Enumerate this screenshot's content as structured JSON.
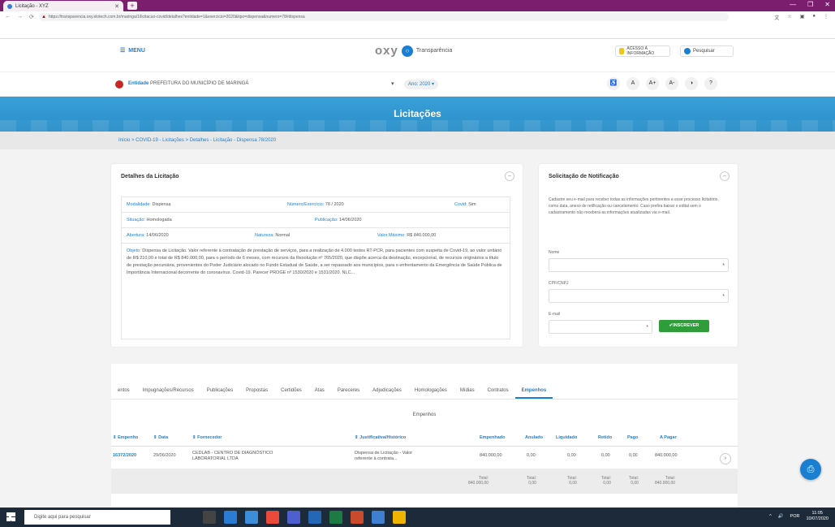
{
  "browser": {
    "tab_title": "Licitação - XYZ",
    "url": "https://transparencia.oxy.elotech.com.br/maringa/1/licitacao-covid/detalhes?entidade=1&exercicio=2020&tipo=dispensa&numero=78#dispensa",
    "new_tab": "+",
    "win_minimize": "—",
    "win_maximize": "❐",
    "win_close": "✕",
    "back": "←",
    "forward": "→",
    "reload": "⟳",
    "lock": "▲"
  },
  "header": {
    "menu_label": "MENU",
    "logo_word": "oxy",
    "logo_mark": "○",
    "logo_text": "Transparência",
    "acesso_label": "ACESSO À INFORMAÇÃO",
    "pesquisar_label": "Pesquisar"
  },
  "entity": {
    "label": "Entidade",
    "value": "PREFEITURA DO MUNICÍPIO DE MARINGÁ",
    "caret": "▾",
    "ano": "Ano: 2020 ▾",
    "tools": [
      "♿",
      "A",
      "A+",
      "A-",
      "◑",
      "?"
    ]
  },
  "banner": {
    "title": "Licitações"
  },
  "breadcrumb": "Início  >  COVID-19 - Licitações  >  Detalhes - Licitação - Dispensa 78/2020",
  "details": {
    "title": "Detalhes da Licitação",
    "toggle": "−",
    "modalidade_label": "Modalidade:",
    "modalidade": "Dispensa",
    "numero_label": "Número/Exercício:",
    "numero": "78 / 2020",
    "covid_label": "Covid:",
    "covid": "Sim",
    "situacao_label": "Situação:",
    "situacao": "Homologada",
    "publicacao_label": "Publicação:",
    "publicacao": "14/06/2020",
    "abertura_label": "Abertura:",
    "abertura": "14/06/2020",
    "natureza_label": "Natureza:",
    "natureza": "Normal",
    "valor_label": "Valor Máximo:",
    "valor": "R$ 840.000,00",
    "objeto_label": "Objeto:",
    "objeto": "Dispensa de Licitação. Valor referente à contratação de prestação de serviços, para a realização de 4.000 testes RT-PCR, para pacientes com suspeita de Covid-19, ao valor unitário de R$ 210,00 e total de R$ 840.000,00, para o período de 6 meses, com recursos da Resolução nº 765/2020, que dispõe acerca da destinação, excepcional, de recursos originários a título de prestação pecuniária, provenientes do Poder Judiciário alocado no Fundo Estadual de Saúde, a ser repassado aos municípios, para o enfrentamento da Emergência de Saúde Pública de Importância Internacional decorrente do coronavírus. Covid-19. Parecer PROGE nº 1530/2020 e 1531/2020. NLC..."
  },
  "notif": {
    "title": "Solicitação de Notificação",
    "toggle": "−",
    "description": "Cadastre seu e-mail para receber todas as informações pertinentes a esse processo licitatório, como data, anexo de retificação ou cancelamento. Caso prefira baixar o edital sem o cadastramento não receberá as informações atualizadas via e-mail.",
    "nome_label": "Nome",
    "cpf_label": "CPF/CNPJ",
    "email_label": "E-mail",
    "required": "*",
    "button": "✔INSCREVER"
  },
  "tabs": [
    "entos",
    "Impugnações/Recursos",
    "Publicações",
    "Propostas",
    "Certidões",
    "Atas",
    "Pareceres",
    "Adjudicações",
    "Homologações",
    "Mídias",
    "Contratos",
    "Empenhos"
  ],
  "empenhos": {
    "section_title": "Empenhos",
    "columns": {
      "empenho": "⇕ Empenho",
      "data": "⇕ Data",
      "fornecedor": "⇕ Fornecedor",
      "justificativa": "⇕ Justificativa/Histórico",
      "empenhado": "Empenhado",
      "anulado": "Anulado",
      "liquidado": "Liquidado",
      "retido": "Retido",
      "pago": "Pago",
      "apagar": "A Pagar"
    },
    "row": {
      "empenho": "16372/2020",
      "data": "29/06/2020",
      "fornecedor_1": "CEDLAB - CENTRO DE DIAGNÓSTICO",
      "fornecedor_2": "LABORATORIAL LTDA",
      "justificativa_1": "Dispensa de Licitação - Valor",
      "justificativa_2": "referente à contrata...",
      "empenhado": "840.000,00",
      "anulado": "0,00",
      "liquidado": "0,00",
      "retido": "0,00",
      "pago": "0,00",
      "apagar": "840.000,00",
      "arrow": "›"
    },
    "totals": {
      "label": "Total:",
      "empenhado": "840.000,00",
      "anulado": "0,00",
      "liquidado": "0,00",
      "retido": "0,00",
      "pago": "0,00",
      "apagar": "840.000,00"
    }
  },
  "fab": "⎙",
  "taskbar": {
    "search_placeholder": "Digite aqui para pesquisar",
    "tray_1": "^",
    "tray_2": "🔊",
    "tray_3": "POR",
    "time": "11:05",
    "date": "10/07/2020"
  }
}
